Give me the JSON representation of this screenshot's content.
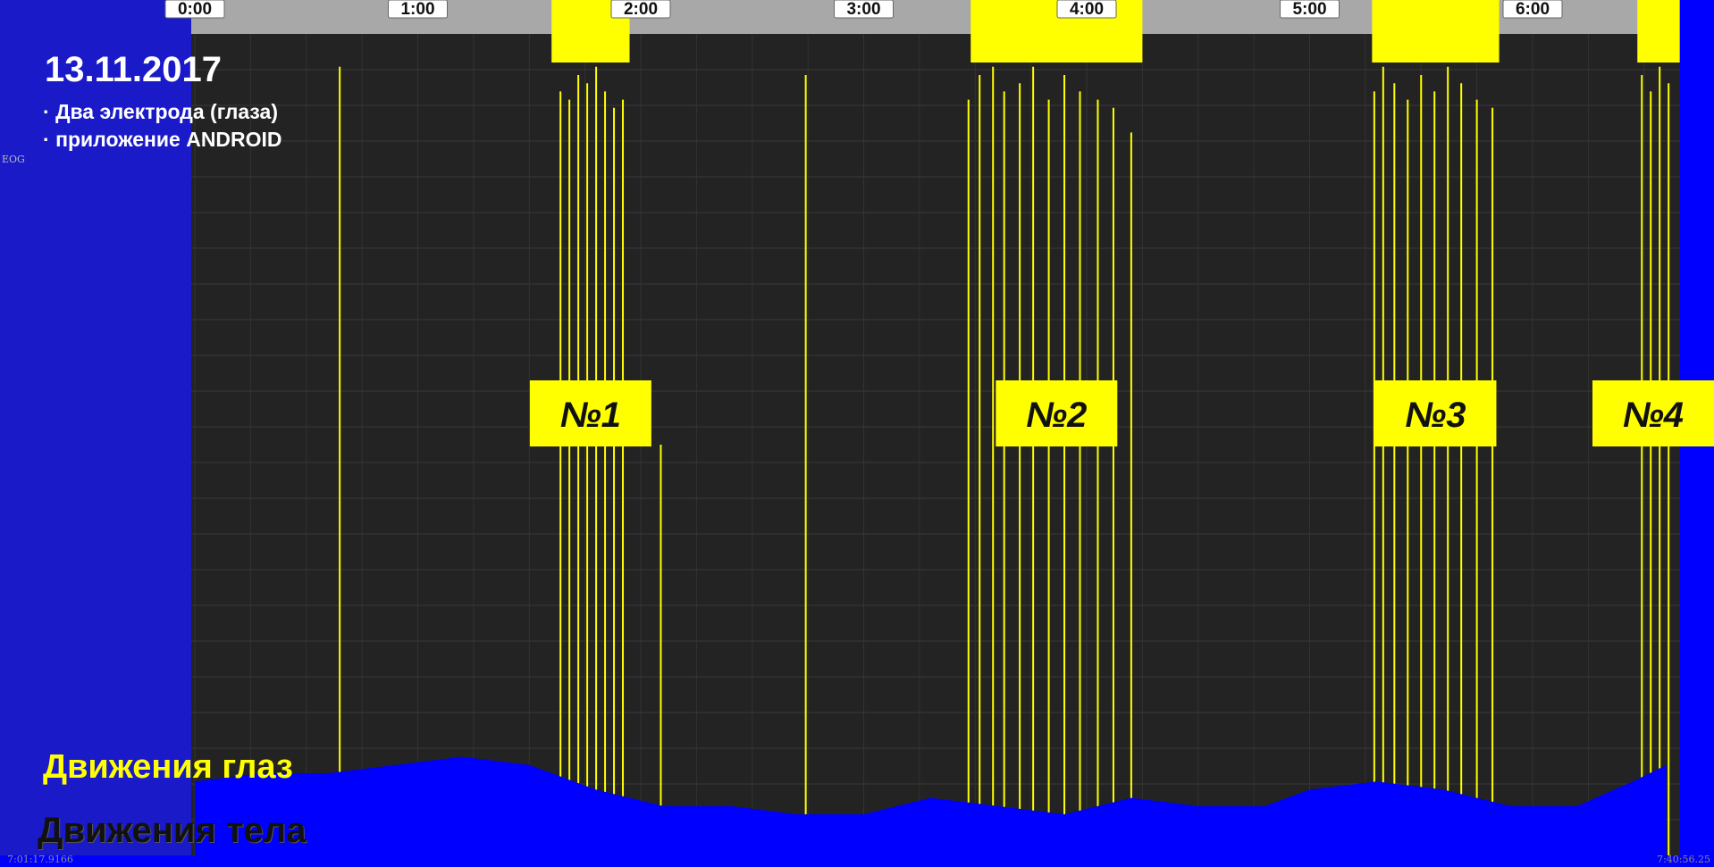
{
  "header": {
    "date": "13.11.2017",
    "bullets": [
      "Два электрода (глаза)",
      "приложение ANDROID"
    ]
  },
  "legend": {
    "eye_movements": "Движения глаз",
    "body_movements": "Движения тела"
  },
  "channel_label": "EOG",
  "recording": {
    "start_time": "7:01:17.9166",
    "end_time": "7:40:56.25"
  },
  "colors": {
    "eye_trace": "#ffff00",
    "body_fill": "#0000ff",
    "plot_background": "#232323",
    "hour_ruler": "#a8a8a8",
    "stage_label_bg": "#ffff00"
  },
  "chart_data": {
    "type": "area",
    "x_axis": {
      "unit": "hours",
      "range": [
        -0.1,
        6.6
      ],
      "tick_labels": [
        "0:00",
        "1:00",
        "2:00",
        "3:00",
        "4:00",
        "5:00",
        "6:00"
      ],
      "tick_values": [
        0,
        1,
        2,
        3,
        4,
        5,
        6
      ]
    },
    "rem_periods": [
      {
        "label": "№1",
        "start": 1.6,
        "end": 1.95
      },
      {
        "label": "№2",
        "start": 3.48,
        "end": 4.25
      },
      {
        "label": "№3",
        "start": 5.28,
        "end": 5.85
      },
      {
        "label": "№4",
        "start": 6.47,
        "end": 6.66
      }
    ],
    "series": [
      {
        "name": "Движения тела",
        "kind": "area",
        "x": [
          0,
          0.3,
          0.6,
          0.9,
          1.2,
          1.5,
          1.8,
          2.1,
          2.4,
          2.7,
          3.0,
          3.3,
          3.6,
          3.9,
          4.2,
          4.5,
          4.8,
          5.0,
          5.3,
          5.6,
          5.9,
          6.2,
          6.45,
          6.6
        ],
        "y": [
          0.09,
          0.1,
          0.1,
          0.11,
          0.12,
          0.11,
          0.08,
          0.06,
          0.06,
          0.05,
          0.05,
          0.07,
          0.06,
          0.05,
          0.07,
          0.06,
          0.06,
          0.08,
          0.09,
          0.08,
          0.06,
          0.06,
          0.09,
          0.11
        ]
      },
      {
        "name": "Движения глаз",
        "kind": "spikes",
        "x": [
          0.65,
          1.64,
          1.68,
          1.72,
          1.76,
          1.8,
          1.84,
          1.88,
          1.92,
          2.09,
          2.74,
          3.47,
          3.52,
          3.58,
          3.63,
          3.7,
          3.76,
          3.83,
          3.9,
          3.97,
          4.05,
          4.12,
          4.2,
          5.29,
          5.33,
          5.38,
          5.44,
          5.5,
          5.56,
          5.62,
          5.68,
          5.75,
          5.82,
          6.49,
          6.53,
          6.57,
          6.61
        ],
        "y": [
          0.96,
          0.93,
          0.92,
          0.95,
          0.94,
          0.96,
          0.93,
          0.91,
          0.92,
          0.5,
          0.95,
          0.92,
          0.95,
          0.96,
          0.93,
          0.94,
          0.96,
          0.92,
          0.95,
          0.93,
          0.92,
          0.91,
          0.88,
          0.93,
          0.96,
          0.94,
          0.92,
          0.95,
          0.93,
          0.96,
          0.94,
          0.92,
          0.91,
          0.95,
          0.93,
          0.96,
          0.94
        ]
      }
    ]
  }
}
